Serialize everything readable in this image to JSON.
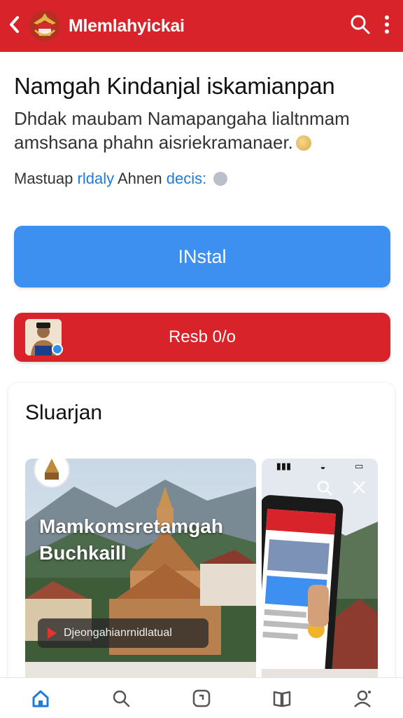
{
  "header": {
    "app_title": "Mlemlahyickai",
    "back_icon": "chevron-left-icon",
    "search_icon": "search-icon",
    "menu_icon": "more-vert-icon"
  },
  "app": {
    "name": "Namgah Kindanjal iskamianpan",
    "description": "Dhdak maubam Namapangaha lialtnmam amshsana phahn aisriekramanaer.",
    "meta_prefix": "Mastuap",
    "meta_link1": "rldaly",
    "meta_mid": "Ahnen",
    "meta_link2": "decis:"
  },
  "actions": {
    "install_label": "INstal",
    "secondary_label": "Resb 0/o"
  },
  "screenshots": {
    "section_title": "Sluarjan",
    "shot1_line1": "Mamkomsretamgah",
    "shot1_line2": "Buchkaill",
    "shot1_pill_text": "Djeongahianrnidlatual"
  },
  "colors": {
    "brand_red": "#d8232a",
    "install_blue": "#3d8ff0",
    "link_blue": "#1f7ad9"
  },
  "bottom_nav": [
    {
      "icon": "home-icon"
    },
    {
      "icon": "search-icon"
    },
    {
      "icon": "apps-icon"
    },
    {
      "icon": "book-icon"
    },
    {
      "icon": "account-icon"
    }
  ]
}
